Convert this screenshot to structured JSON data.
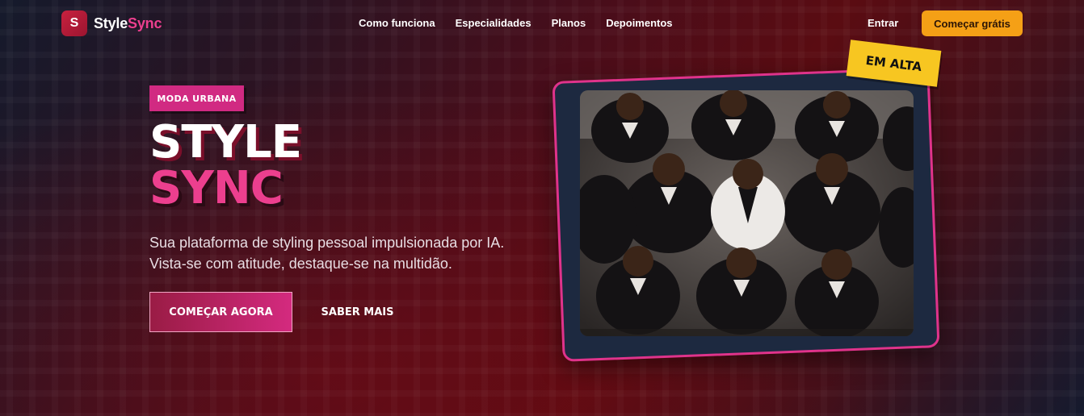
{
  "header": {
    "logo_letter": "S",
    "logo_part1": "Style",
    "logo_part2": "Sync",
    "nav": [
      "Como funciona",
      "Especialidades",
      "Planos",
      "Depoimentos"
    ],
    "login_label": "Entrar",
    "cta_label": "Começar grátis"
  },
  "hero": {
    "badge": "MODA URBANA",
    "title_line1": "STYLE",
    "title_line2": "SYNC",
    "subtitle_line1": "Sua plataforma de styling pessoal impulsionada por IA.",
    "subtitle_line2": "Vista-se com atitude, destaque-se na multidão.",
    "primary_button": "COMEÇAR AGORA",
    "secondary_button": "SABER MAIS"
  },
  "showcase": {
    "sticker": "EM ALTA"
  },
  "colors": {
    "accent_pink": "#ec3f8e",
    "accent_orange": "#f5a016",
    "sticker_yellow": "#f7c621",
    "logo_red": "#c8213f"
  }
}
